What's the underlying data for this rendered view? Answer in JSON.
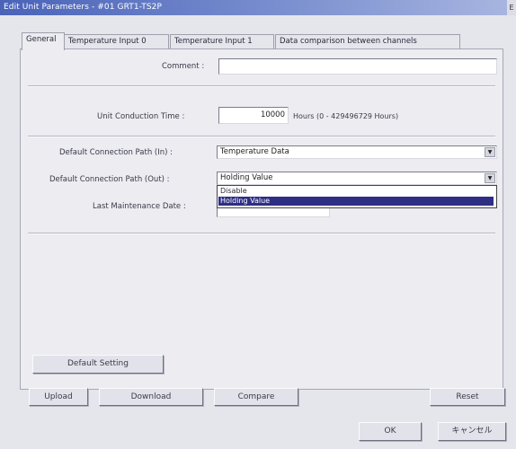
{
  "window": {
    "title": "Edit Unit Parameters - #01 GRT1-TS2P",
    "close_glyph": "E"
  },
  "tabs": [
    {
      "label": "General",
      "active": true
    },
    {
      "label": "Temperature Input 0",
      "active": false
    },
    {
      "label": "Temperature Input 1",
      "active": false
    },
    {
      "label": "Data comparison between channels",
      "active": false
    }
  ],
  "general": {
    "comment_label": "Comment :",
    "comment_value": "",
    "conduction_label": "Unit Conduction Time :",
    "conduction_value": "10000",
    "conduction_hint": "Hours (0 - 429496729 Hours)",
    "conn_in_label": "Default Connection Path (In) :",
    "conn_in_value": "Temperature Data",
    "conn_out_label": "Default Connection Path (Out) :",
    "conn_out_value": "Holding Value",
    "conn_out_options": [
      "Disable",
      "Holding Value"
    ],
    "maintenance_label": "Last Maintenance Date :"
  },
  "buttons": {
    "default_setting": "Default Setting",
    "upload": "Upload",
    "download": "Download",
    "compare": "Compare",
    "reset": "Reset",
    "ok": "OK",
    "cancel": "キャンセル"
  },
  "colors": {
    "title_start": "#4a63b9",
    "selection": "#2e2e85",
    "dialog_bg": "#e5e6ec"
  }
}
